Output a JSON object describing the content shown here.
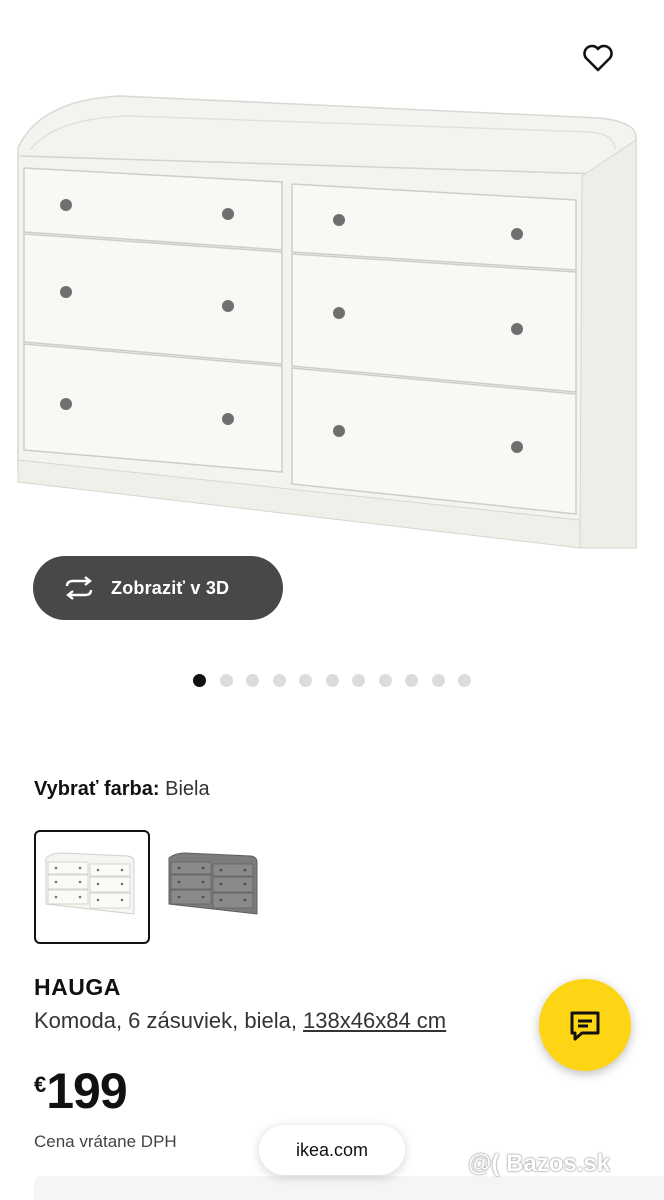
{
  "header": {
    "favorite_icon": "heart-icon"
  },
  "gallery": {
    "view3d_label": "Zobraziť v 3D",
    "view3d_icon": "rotate-3d-icon",
    "slide_count": 11,
    "active_slide": 1
  },
  "color": {
    "label": "Vybrať farba:",
    "value": "Biela",
    "options": [
      "white",
      "gray"
    ],
    "selected": "white"
  },
  "product": {
    "name": "HAUGA",
    "desc": "Komoda, 6 zásuviek, biela, ",
    "dims": "138x46x84 cm",
    "currency": "€",
    "price": "199",
    "vat_note": "Cena vrátane DPH"
  },
  "chat": {
    "icon": "chat-icon",
    "color": "#fdd515"
  },
  "browser": {
    "url": "ikea.com"
  },
  "watermark": "@( Bazos.sk"
}
